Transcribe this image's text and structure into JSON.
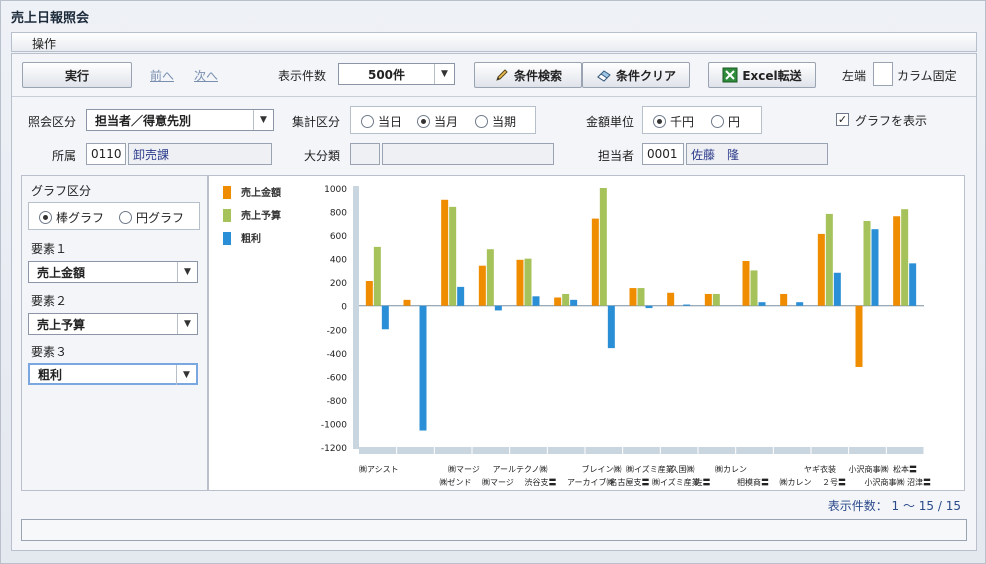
{
  "window": {
    "title": "売上日報照会"
  },
  "menu": {
    "operation": "操作"
  },
  "toolbar": {
    "run": "実行",
    "prev": "前へ",
    "next": "次へ",
    "display_count_label": "表示件数",
    "display_count_value": "500件",
    "search": "条件検索",
    "clear": "条件クリア",
    "excel": "Excel転送",
    "left_label": "左端",
    "column_fixed": "カラム固定"
  },
  "filters": {
    "inquiry_label": "照会区分",
    "inquiry_value": "担当者／得意先別",
    "aggregate_label": "集計区分",
    "aggregate_options": [
      "当日",
      "当月",
      "当期"
    ],
    "aggregate_selected": 1,
    "amount_unit_label": "金額単位",
    "amount_unit_options": [
      "千円",
      "円"
    ],
    "amount_unit_selected": 0,
    "show_graph_label": "グラフを表示",
    "show_graph_checked": true,
    "dept_label": "所属",
    "dept_code": "0110",
    "dept_name": "卸売課",
    "category_label": "大分類",
    "category_code": "",
    "category_name": "",
    "staff_label": "担当者",
    "staff_code": "0001",
    "staff_name": "佐藤　隆"
  },
  "graph_settings": {
    "type_label": "グラフ区分",
    "type_options": [
      "棒グラフ",
      "円グラフ"
    ],
    "type_selected": 0,
    "element1_label": "要素１",
    "element1_value": "売上金額",
    "element2_label": "要素２",
    "element2_value": "売上予算",
    "element3_label": "要素３",
    "element3_value": "粗利"
  },
  "footer": {
    "count_text": "表示件数： 1 ～ 15 / 15"
  },
  "colors": {
    "sales": "#f08c00",
    "budget": "#a6c25a",
    "profit": "#2a8fd6"
  },
  "chart_data": {
    "type": "bar",
    "ylim": [
      -1200,
      1000
    ],
    "yticks": [
      1000,
      800,
      600,
      400,
      200,
      0,
      -200,
      -400,
      -600,
      -800,
      -1000,
      -1200
    ],
    "categories_upper": [
      "㈱アシスト",
      "",
      "㈱マージ",
      "アールテクノ㈱",
      "",
      "ブレイン㈱",
      "㈱イズミ産業",
      "久国㈱",
      "㈱カレン",
      "",
      "ヤギ衣装",
      "小沢商事㈱",
      "松本〓"
    ],
    "categories_lower": [
      "",
      "㈱ゼンド",
      "㈱マージ",
      "渋谷支〓",
      "アーカイブ㈱",
      "名古屋支〓",
      "㈱イズミ産業",
      "佐〓",
      "相模商〓",
      "㈱カレン",
      "２号〓",
      "小沢商事㈱",
      "沼津〓"
    ],
    "series": [
      {
        "name": "売上金額",
        "values": [
          210,
          50,
          900,
          340,
          390,
          70,
          740,
          150,
          110,
          100,
          380,
          100,
          610,
          -520,
          760
        ]
      },
      {
        "name": "売上予算",
        "values": [
          500,
          0,
          840,
          480,
          400,
          100,
          1000,
          150,
          0,
          100,
          300,
          0,
          780,
          720,
          820
        ]
      },
      {
        "name": "粗利",
        "values": [
          -200,
          -1060,
          160,
          -40,
          80,
          50,
          -360,
          -20,
          10,
          0,
          30,
          30,
          280,
          650,
          360
        ]
      }
    ]
  }
}
